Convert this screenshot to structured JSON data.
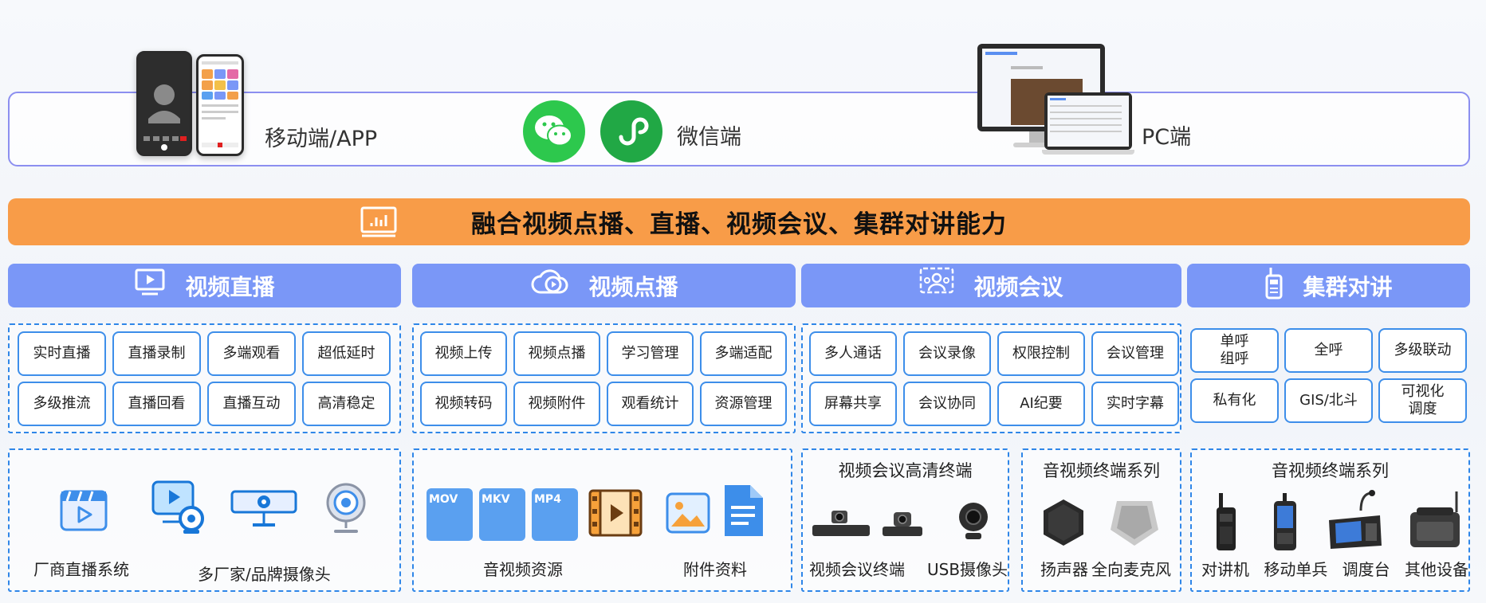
{
  "clients": {
    "mobile_label": "移动端/APP",
    "wechat_label": "微信端",
    "pc_label": "PC端"
  },
  "banner": {
    "title": "融合视频点播、直播、视频会议、集群对讲能力"
  },
  "categories": [
    {
      "title": "视频直播",
      "icon": "monitor-play-icon",
      "features": [
        "实时直播",
        "直播录制",
        "多端观看",
        "超低延时",
        "多级推流",
        "直播回看",
        "直播互动",
        "高清稳定"
      ]
    },
    {
      "title": "视频点播",
      "icon": "cloud-play-icon",
      "features": [
        "视频上传",
        "视频点播",
        "学习管理",
        "多端适配",
        "视频转码",
        "视频附件",
        "观看统计",
        "资源管理"
      ]
    },
    {
      "title": "视频会议",
      "icon": "meeting-people-icon",
      "features": [
        "多人通话",
        "会议录像",
        "权限控制",
        "会议管理",
        "屏幕共享",
        "会议协同",
        "AI纪要",
        "实时字幕"
      ]
    },
    {
      "title": "集群对讲",
      "icon": "walkie-talkie-icon",
      "features": [
        "单呼\n组呼",
        "全呼",
        "多级联动",
        "私有化",
        "GIS/北斗",
        "可视化\n调度"
      ]
    }
  ],
  "resources": {
    "live": {
      "vendor_system": "厂商直播系统",
      "cameras": "多厂家/品牌摄像头"
    },
    "vod": {
      "av_resources": "音视频资源",
      "attachments": "附件资料",
      "file_tags": [
        "MOV",
        "MKV",
        "MP4"
      ]
    },
    "meeting": {
      "title": "视频会议高清终端",
      "terminal": "视频会议终端",
      "usb_camera": "USB摄像头"
    },
    "av_terminal": {
      "title": "音视频终端系列",
      "speaker": "扬声器",
      "mic": "全向麦克风"
    },
    "trunk_terminal": {
      "title": "音视频终端系列",
      "items": [
        "对讲机",
        "移动单兵",
        "调度台",
        "其他设备"
      ]
    }
  },
  "colors": {
    "banner": "#f89c48",
    "category_header": "#7a97f7",
    "chip_border": "#3d8eea",
    "dash_border": "#2f86e8",
    "client_border": "#8c8ff0",
    "wechat_green": "#2dc84d"
  }
}
